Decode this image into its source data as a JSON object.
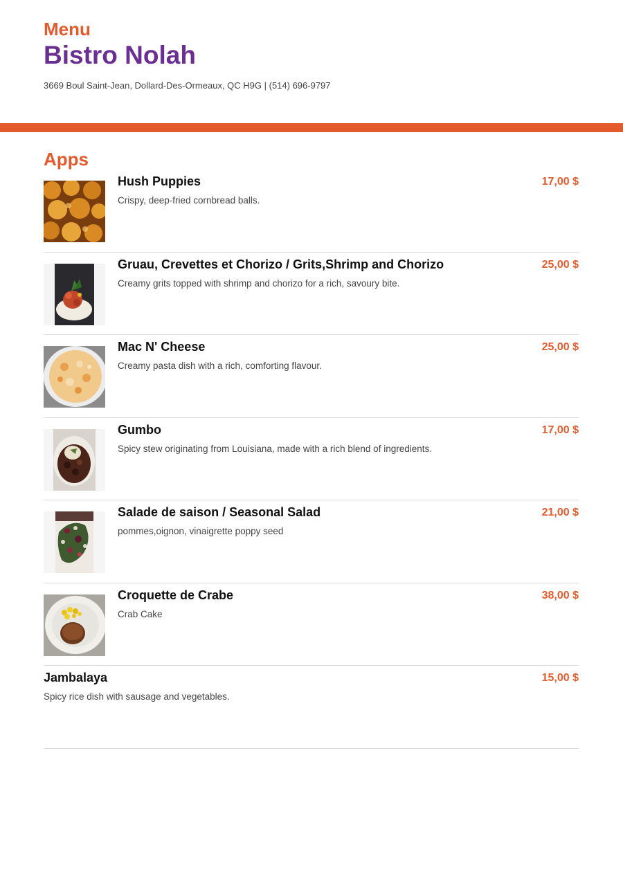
{
  "header": {
    "menu_label": "Menu",
    "restaurant_name": "Bistro Nolah",
    "address": "3669 Boul Saint-Jean, Dollard-Des-Ormeaux, QC H9G | (514) 696-9797"
  },
  "colors": {
    "accent": "#e35b2c",
    "brand": "#6b2f93"
  },
  "section": {
    "title": "Apps",
    "items": [
      {
        "name": "Hush Puppies",
        "description": "Crispy, deep-fried cornbread balls.",
        "price": "17,00 $",
        "image": "hush-puppies-photo"
      },
      {
        "name": "Gruau, Crevettes et Chorizo / Grits,Shrimp and Chorizo",
        "description": "Creamy grits topped with shrimp and chorizo for a rich, savoury bite.",
        "price": "25,00 $",
        "image": "grits-shrimp-photo"
      },
      {
        "name": "Mac N' Cheese",
        "description": "Creamy pasta dish with a rich, comforting flavour.",
        "price": "25,00 $",
        "image": "mac-n-cheese-photo"
      },
      {
        "name": "Gumbo",
        "description": "Spicy stew originating from Louisiana, made with a rich blend of ingredients.",
        "price": "17,00 $",
        "image": "gumbo-photo"
      },
      {
        "name": "Salade de saison / Seasonal Salad",
        "description": "pommes,oignon, vinaigrette poppy seed",
        "price": "21,00 $",
        "image": "seasonal-salad-photo"
      },
      {
        "name": "Croquette de Crabe",
        "description": "Crab Cake",
        "price": "38,00 $",
        "image": "crab-cake-photo"
      },
      {
        "name": "Jambalaya",
        "description": "Spicy rice dish with sausage and vegetables.",
        "price": "15,00 $",
        "image": ""
      }
    ]
  }
}
